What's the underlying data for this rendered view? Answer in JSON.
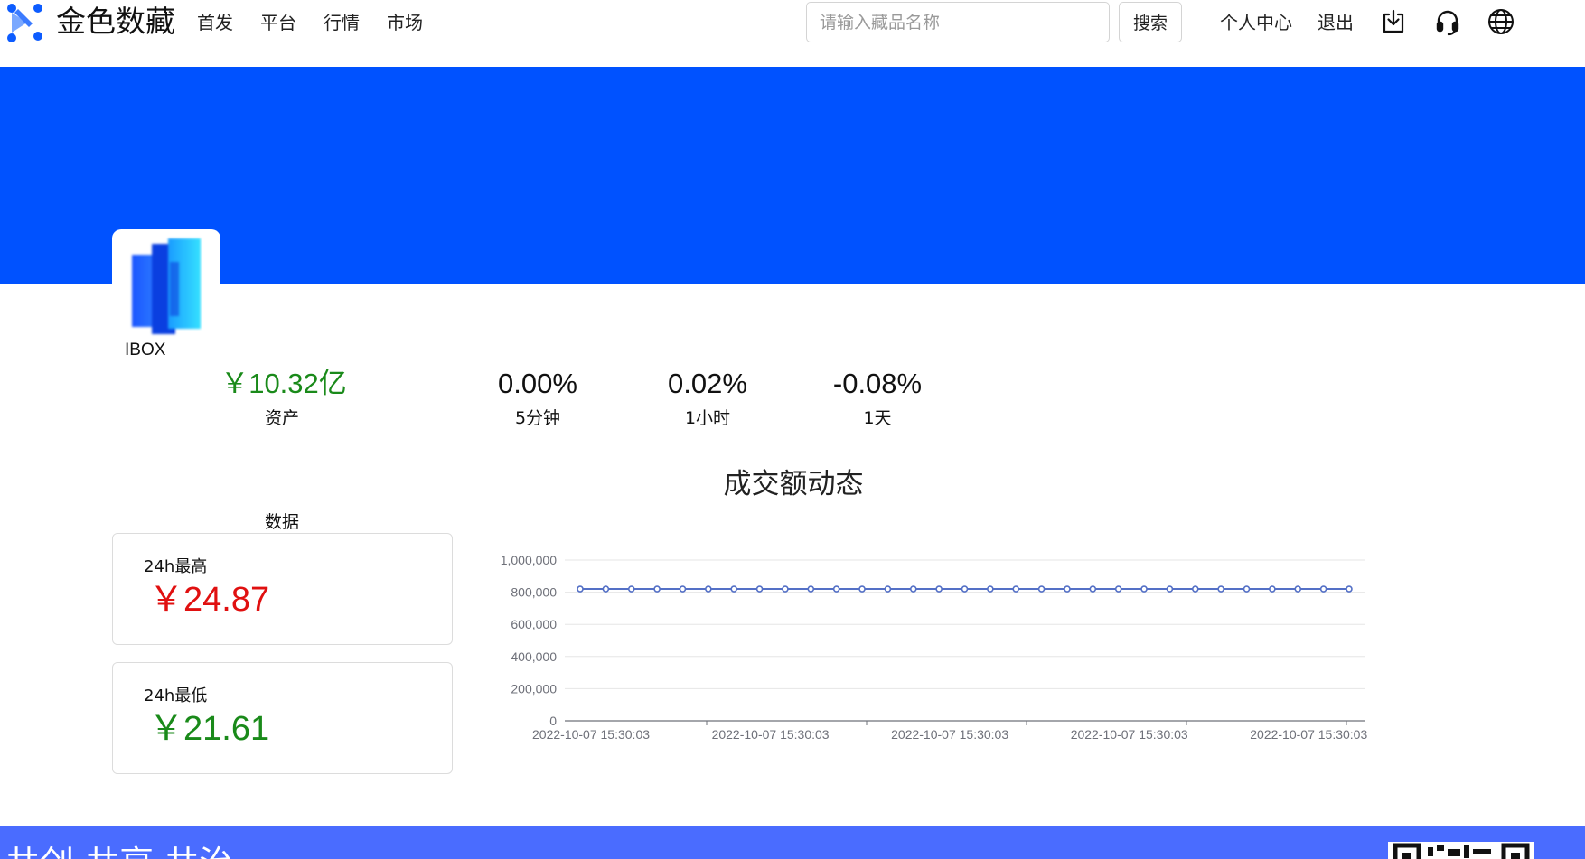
{
  "header": {
    "brand": "金色数藏",
    "nav": [
      "首发",
      "平台",
      "行情",
      "市场"
    ],
    "search_placeholder": "请输入藏品名称",
    "search_button": "搜索",
    "user_center": "个人中心",
    "logout": "退出"
  },
  "platform": {
    "name": "IBOX"
  },
  "stats": {
    "assets_value": "￥10.32亿",
    "assets_label": "资产",
    "change_5m_value": "0.00%",
    "change_5m_label": "5分钟",
    "change_1h_value": "0.02%",
    "change_1h_label": "1小时",
    "change_1d_value": "-0.08%",
    "change_1d_label": "1天"
  },
  "data_panel": {
    "title": "数据",
    "high_label": "24h最高",
    "high_value": "￥24.87",
    "low_label": "24h最低",
    "low_value": "￥21.61"
  },
  "colors": {
    "brand_blue": "#0052ff",
    "up_green": "#1a8a1a",
    "down_red": "#e01010",
    "line": "#5470c6",
    "footer": "#4a6cff"
  },
  "chart_data": {
    "type": "line",
    "title": "成交额动态",
    "ylim": [
      0,
      1000000
    ],
    "y_ticks": [
      "0",
      "200,000",
      "400,000",
      "600,000",
      "800,000",
      "1,000,000"
    ],
    "y_tick_values": [
      0,
      200000,
      400000,
      600000,
      800000,
      1000000
    ],
    "x_tick_labels": [
      "2022-10-07 15:30:03",
      "2022-10-07 15:30:03",
      "2022-10-07 15:30:03",
      "2022-10-07 15:30:03",
      "2022-10-07 15:30:03"
    ],
    "grid": true,
    "series": [
      {
        "values": [
          820000,
          820000,
          820000,
          820000,
          820000,
          820000,
          820000,
          820000,
          820000,
          820000,
          820000,
          820000,
          820000,
          820000,
          820000,
          820000,
          820000,
          820000,
          820000,
          820000,
          820000,
          820000,
          820000,
          820000,
          820000,
          820000,
          820000,
          820000,
          820000,
          820000,
          820000
        ]
      }
    ]
  },
  "footer": {
    "slogan": "共创 共享 共治"
  }
}
